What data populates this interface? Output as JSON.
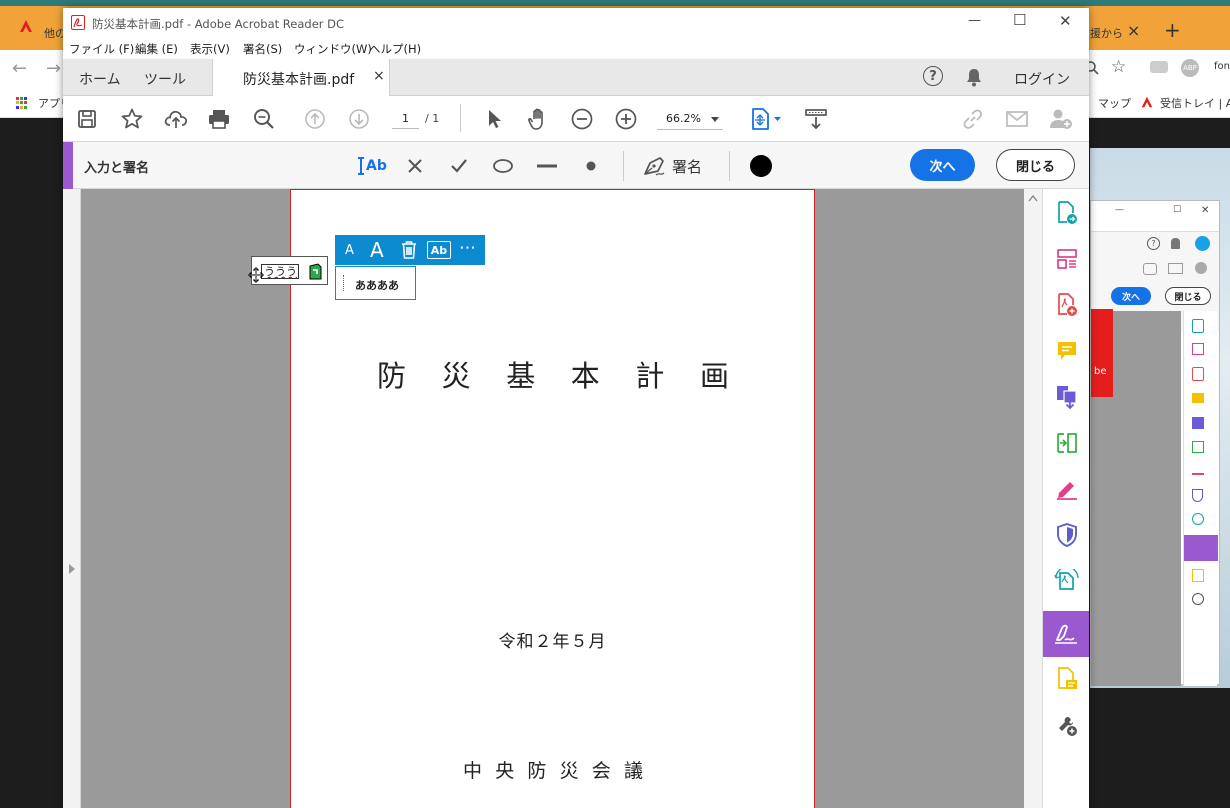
{
  "background_browser": {
    "tab_left_label": "他の",
    "tab_right_label": "援から",
    "tab_close": "×",
    "new_tab": "+",
    "bookmark_apps": "アプリ",
    "bookmark_maps": "マップ",
    "bookmark_inbox": "受信トレイ | A",
    "addr_right_text": "font",
    "abp_label": "ABP"
  },
  "window": {
    "title": "防災基本計画.pdf - Adobe Acrobat Reader DC",
    "minimize": "—",
    "maximize": "☐",
    "close": "✕"
  },
  "menu": {
    "items": [
      "ファイル (F)",
      "編集 (E)",
      "表示(V)",
      "署名(S)",
      "ウィンドウ(W)",
      "ヘルプ(H)"
    ]
  },
  "tabs": {
    "home": "ホーム",
    "tools": "ツール",
    "document": "防災基本計画.pdf",
    "doc_close": "×",
    "help": "?",
    "login": "ログイン"
  },
  "toolbar": {
    "page_current": "1",
    "page_total": "/ 1",
    "zoom": "66.2%"
  },
  "signbar": {
    "title": "入力と署名",
    "text_tool": "Ab",
    "sign_label": "署名",
    "next_label": "次へ",
    "close_label": "閉じる",
    "ink_color": "#000000"
  },
  "document": {
    "title_chars": [
      "防",
      "災",
      "基",
      "本",
      "計",
      "画"
    ],
    "date": "令和２年５月",
    "org_chars": [
      "中",
      "央",
      "防",
      "災",
      "会",
      "議"
    ]
  },
  "annotation": {
    "tool_small_a": "A",
    "tool_large_a": "A",
    "tool_ab": "Ab",
    "tool_more": "⋯",
    "text_value": "ああああ",
    "field_value": "ううう"
  },
  "colors": {
    "accent_blue": "#1473e6",
    "annot_blue": "#0d8bd1",
    "sign_purple": "#9b59d0",
    "page_border": "#cc2222",
    "acrobat_red": "#e51d1d"
  },
  "mini_window": {
    "minimize": "—",
    "maximize": "☐",
    "close": "✕",
    "next_label": "次へ",
    "close_label": "閉じる",
    "logo_text": "be"
  }
}
